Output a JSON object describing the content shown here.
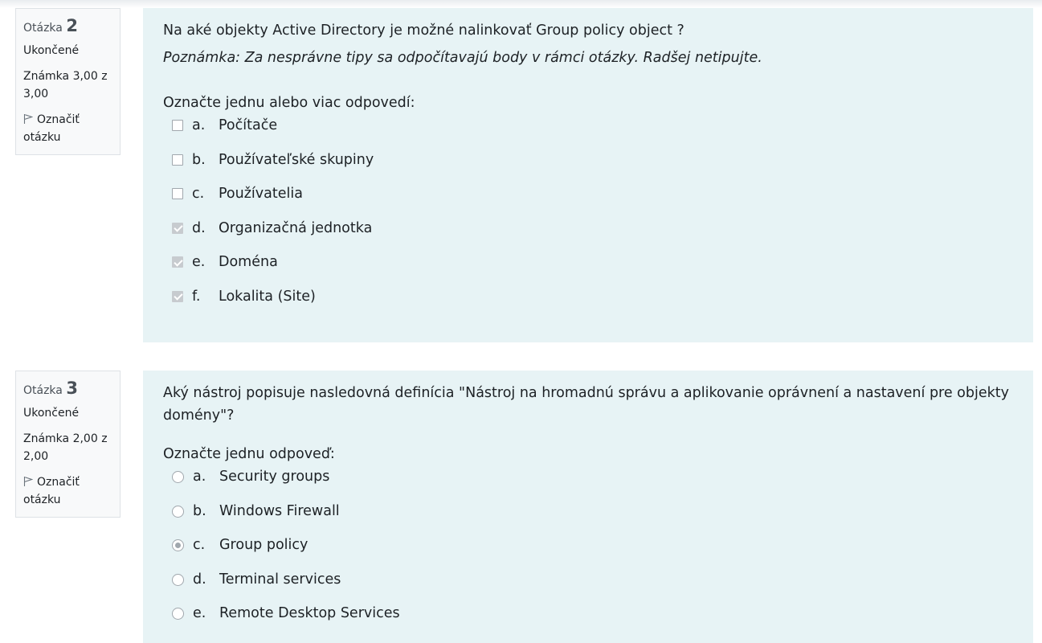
{
  "questions": [
    {
      "label": "Otázka",
      "number": "2",
      "state": "Ukončené",
      "grade": "Známka 3,00 z 3,00",
      "flag_label": "Označiť otázku",
      "text": "Na aké objekty Active Directory je možné nalinkovať Group policy object ?",
      "note": "Poznámka: Za nesprávne tipy sa odpočítavajú body v rámci otázky. Radšej netipujte.",
      "prompt": "Označte jednu alebo viac odpovedí:",
      "input_type": "checkbox",
      "options": [
        {
          "letter": "a.",
          "text": "Počítače",
          "checked": false
        },
        {
          "letter": "b.",
          "text": "Používateľské skupiny",
          "checked": false
        },
        {
          "letter": "c.",
          "text": "Používatelia",
          "checked": false
        },
        {
          "letter": "d.",
          "text": "Organizačná jednotka",
          "checked": true
        },
        {
          "letter": "e.",
          "text": "Doména",
          "checked": true
        },
        {
          "letter": "f.",
          "text": "Lokalita (Site)",
          "checked": true
        }
      ]
    },
    {
      "label": "Otázka",
      "number": "3",
      "state": "Ukončené",
      "grade": "Známka 2,00 z 2,00",
      "flag_label": "Označiť otázku",
      "text": "Aký nástroj popisuje nasledovná definícia \"Nástroj na hromadnú správu a aplikovanie oprávnení a nastavení pre objekty domény\"?",
      "prompt": "Označte jednu odpoveď:",
      "input_type": "radio",
      "options": [
        {
          "letter": "a.",
          "text": "Security groups",
          "checked": false
        },
        {
          "letter": "b.",
          "text": "Windows Firewall",
          "checked": false
        },
        {
          "letter": "c.",
          "text": "Group policy",
          "checked": true
        },
        {
          "letter": "d.",
          "text": "Terminal services",
          "checked": false
        },
        {
          "letter": "e.",
          "text": "Remote Desktop Services",
          "checked": false
        }
      ]
    }
  ],
  "colors": {
    "content_bg": "#e7f3f5",
    "info_bg": "#f8f9fa",
    "checked_control": "#c7cbcf"
  },
  "icons": {
    "flag": "flag-icon"
  }
}
